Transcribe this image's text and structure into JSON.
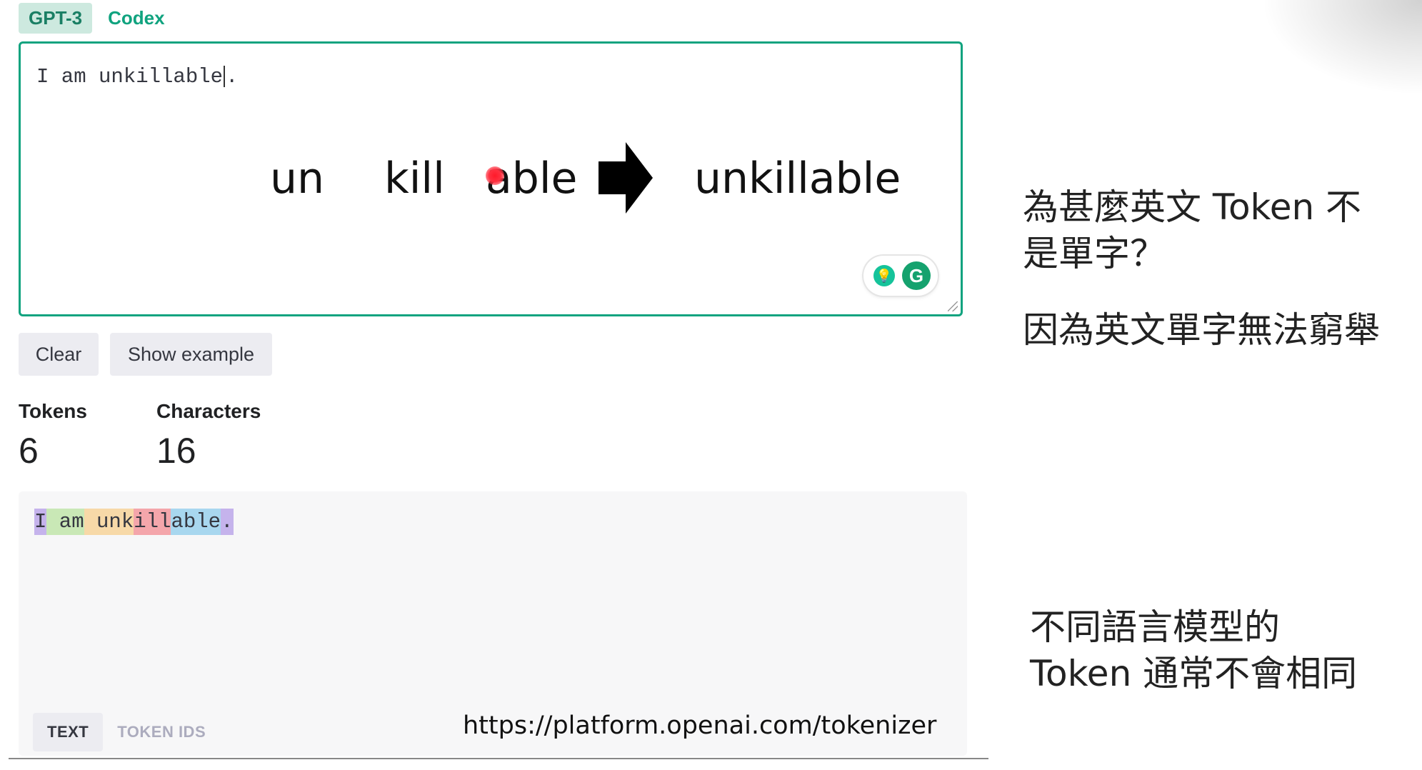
{
  "model_tabs": [
    {
      "label": "GPT-3",
      "active": true
    },
    {
      "label": "Codex",
      "active": false
    }
  ],
  "input": {
    "before_caret": "I am unkillable",
    "after_caret": "."
  },
  "overlay": {
    "parts": [
      "un",
      "kill",
      "able"
    ],
    "combined": "unkillable"
  },
  "buttons": {
    "clear": "Clear",
    "show_example": "Show example"
  },
  "stats": {
    "tokens_label": "Tokens",
    "tokens_value": "6",
    "characters_label": "Characters",
    "characters_value": "16"
  },
  "tokens": [
    {
      "text": "I",
      "color": "#c5b3ec"
    },
    {
      "text": " am",
      "color": "#c9e8b6"
    },
    {
      "text": " unk",
      "color": "#f7d9a8"
    },
    {
      "text": "ill",
      "color": "#f4a6ab"
    },
    {
      "text": "able",
      "color": "#a8d7ef"
    },
    {
      "text": ".",
      "color": "#c5b3ec"
    }
  ],
  "result_tabs": [
    {
      "label": "TEXT",
      "active": true
    },
    {
      "label": "TOKEN IDS",
      "active": false
    }
  ],
  "url": "https://platform.openai.com/tokenizer",
  "notes": {
    "question_line1": "為甚麼英文 Token 不",
    "question_line2": "是單字？",
    "answer": "因為英文單字無法窮舉",
    "remark_line1": "不同語言模型的",
    "remark_line2": "Token 通常不會相同"
  },
  "extension_icons": [
    "lightbulb-icon",
    "grammarly-icon"
  ]
}
